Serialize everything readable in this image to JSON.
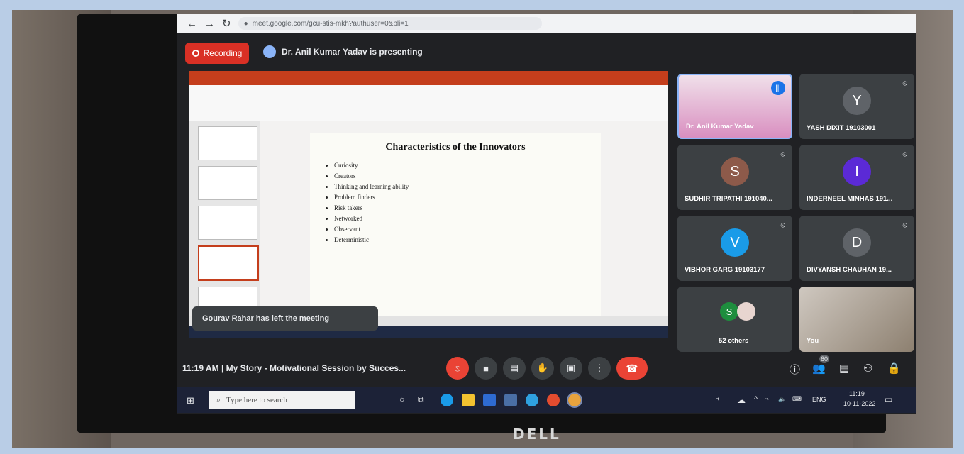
{
  "browser": {
    "url": "meet.google.com/gcu-stis-mkh?authuser=0&pli=1"
  },
  "meet": {
    "recording_label": "Recording",
    "presenting_text": "Dr. Anil Kumar Yadav is presenting",
    "toast_text": "Gourav Rahar has left the meeting",
    "meeting_time": "11:19 AM",
    "meeting_sep": "|",
    "meeting_title": "My Story - Motivational Session by Succes...",
    "participant_count_badge": "60"
  },
  "slide": {
    "title": "Characteristics of the Innovators",
    "bullets": [
      "Curiosity",
      "Creators",
      "Thinking and learning ability",
      "Problem finders",
      "Risk takers",
      "Networked",
      "Observant",
      "Deterministic"
    ]
  },
  "participants": [
    {
      "name": "Dr. Anil Kumar Yadav",
      "initial": "",
      "color": "#d98fc0"
    },
    {
      "name": "YASH DIXIT 19103001",
      "initial": "Y",
      "color": "#5f6368"
    },
    {
      "name": "SUDHIR TRIPATHI 191040...",
      "initial": "S",
      "color": "#8d5a4a"
    },
    {
      "name": "INDERNEEL MINHAS 191...",
      "initial": "I",
      "color": "#5b2ad6"
    },
    {
      "name": "VIBHOR GARG 19103177",
      "initial": "V",
      "color": "#1a9be8"
    },
    {
      "name": "DIVYANSH CHAUHAN 19...",
      "initial": "D",
      "color": "#5f6368"
    },
    {
      "name": "52 others",
      "initial": "S",
      "color": "#1e8e3e"
    },
    {
      "name": "You",
      "initial": "",
      "color": "#8d8070"
    }
  ],
  "taskbar": {
    "search_placeholder": "Type here to search",
    "time": "11:19",
    "date": "10-11-2022",
    "lang": "ENG"
  },
  "brand": "DELL"
}
